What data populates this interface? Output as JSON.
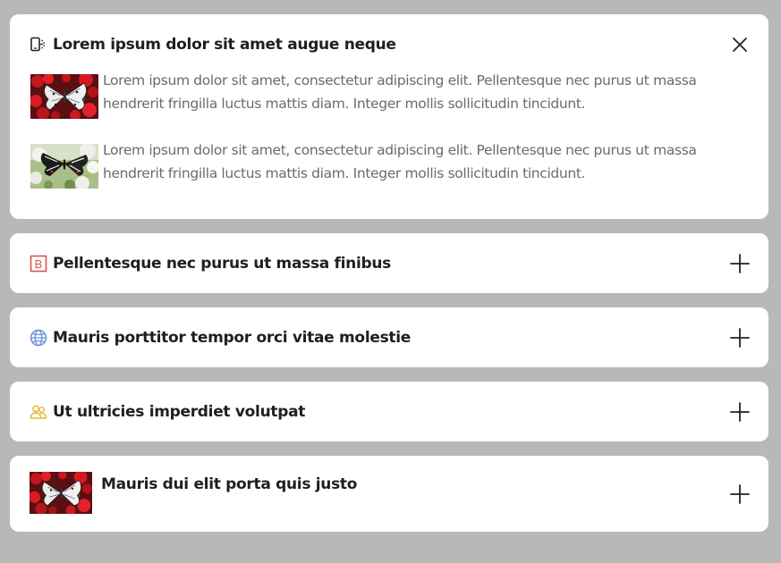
{
  "accordion": {
    "panels": [
      {
        "title": "Lorem ipsum dolor sit amet augue neque",
        "icon": "mobile-sync-icon",
        "state": "open",
        "toggle_icon": "close-icon",
        "items": [
          {
            "image": "butterfly-red-flowers-image",
            "text": "Lorem ipsum dolor sit amet, consectetur adipiscing elit. Pellentesque nec purus ut massa hendrerit fringilla luctus mattis diam. Integer mollis sollicitudin tincidunt."
          },
          {
            "image": "butterfly-white-flowers-image",
            "text": "Lorem ipsum dolor sit amet, consectetur adipiscing elit. Pellentesque nec purus ut massa hendrerit fringilla luctus mattis diam. Integer mollis sollicitudin tincidunt."
          }
        ]
      },
      {
        "title": "Pellentesque nec purus ut massa finibus",
        "icon": "bold-letter-icon",
        "icon_letter": "B",
        "state": "collapsed",
        "toggle_icon": "plus-icon"
      },
      {
        "title": "Mauris porttitor tempor orci vitae molestie",
        "icon": "globe-icon",
        "state": "collapsed",
        "toggle_icon": "plus-icon"
      },
      {
        "title": "Ut ultricies imperdiet volutpat",
        "icon": "users-icon",
        "state": "collapsed",
        "toggle_icon": "plus-icon"
      },
      {
        "title": "Mauris dui elit porta quis justo",
        "icon": "butterfly-red-flowers-image",
        "state": "collapsed",
        "toggle_icon": "plus-icon"
      }
    ]
  },
  "colors": {
    "page_background": "#b8b8b8",
    "panel_background": "#ffffff",
    "title_text": "#1f1f1f",
    "body_text": "#6b6b6b",
    "bold_icon": "#d9534f",
    "globe_icon": "#6b8fd6",
    "users_icon": "#e3b93b"
  }
}
